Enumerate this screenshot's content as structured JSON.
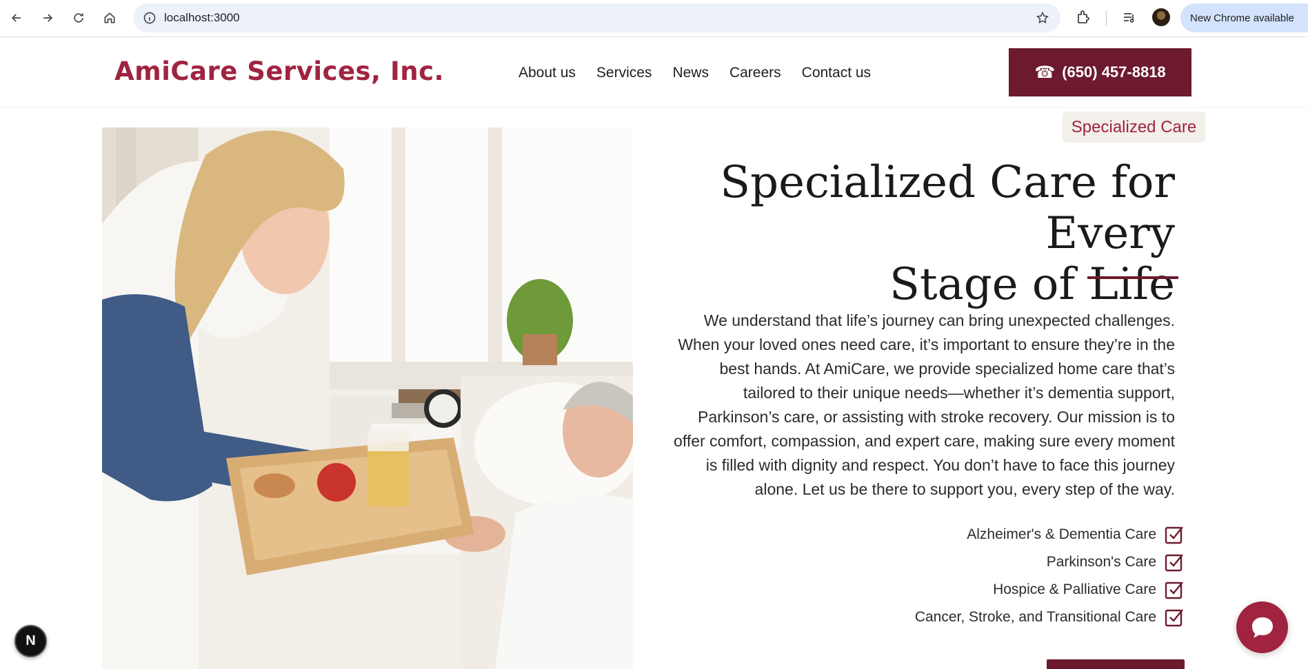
{
  "browser": {
    "url": "localhost:3000",
    "update_label": "New Chrome available"
  },
  "header": {
    "logo": "AmiCare Services, Inc.",
    "nav": [
      "About us",
      "Services",
      "News",
      "Careers",
      "Contact us"
    ],
    "phone": "(650) 457-8818"
  },
  "hero": {
    "tag": "Specialized Care",
    "headline_line1": "Specialized Care for Every",
    "headline_line2": "Stage of Life",
    "body": "We understand that life’s journey can bring unexpected challenges. When your loved ones need care, it’s important to ensure they’re in the best hands. At AmiCare, we provide specialized home care that’s tailored to their unique needs—whether it’s dementia support, Parkinson’s care, or assisting with stroke recovery. Our mission is to offer comfort, compassion, and expert care, making sure every moment is filled with dignity and respect. You don’t have to face this journey alone. Let us be there to support you, every step of the way.",
    "features": [
      "Alzheimer's & Dementia Care",
      "Parkinson's Care",
      "Hospice & Palliative Care",
      "Cancer, Stroke, and Transitional Care"
    ]
  },
  "dev_badge": "N",
  "colors": {
    "brand": "#a0243f",
    "brand_dark": "#6d1a2e"
  }
}
